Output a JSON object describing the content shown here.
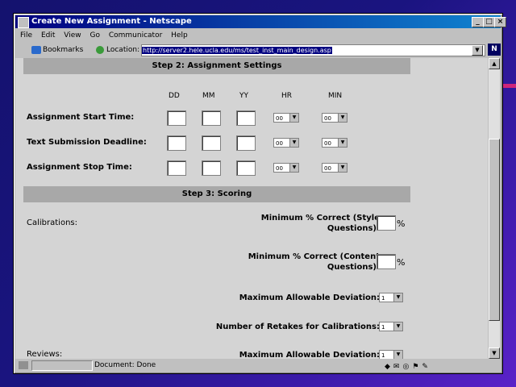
{
  "window": {
    "title": "Create New Assignment - Netscape",
    "controls": [
      "_",
      "□",
      "×"
    ]
  },
  "menu": [
    "File",
    "Edit",
    "View",
    "Go",
    "Communicator",
    "Help"
  ],
  "toolbar": {
    "bookmarks_label": "Bookmarks",
    "location_label": "Location:",
    "url": "http://server2.hele.ucla.edu/ms/test_inst_main_design.asp"
  },
  "step2": {
    "header": "Step 2: Assignment Settings",
    "columns": [
      "DD",
      "MM",
      "YY",
      "HR",
      "MIN"
    ],
    "rows": [
      {
        "label": "Assignment Start Time:",
        "hr": "00",
        "min": "00"
      },
      {
        "label": "Text Submission Deadline:",
        "hr": "00",
        "min": "00"
      },
      {
        "label": "Assignment Stop Time:",
        "hr": "00",
        "min": "00"
      }
    ]
  },
  "step3": {
    "header": "Step 3: Scoring",
    "calibrations_label": "Calibrations:",
    "min_style_line1": "Minimum % Correct (Style",
    "min_style_line2": "Questions):",
    "min_content_line1": "Minimum % Correct (Content",
    "min_content_line2": "Questions):",
    "percent": "%",
    "max_deviation_label": "Maximum Allowable Deviation:",
    "max_deviation_value": "1",
    "retakes_label": "Number of Retakes for Calibrations:",
    "retakes_value": "1",
    "reviews_label": "Reviews:",
    "reviews_max_deviation_label": "Maximum Allowable Deviation:",
    "reviews_max_deviation_value": "1"
  },
  "status": {
    "text": "Document: Done"
  }
}
